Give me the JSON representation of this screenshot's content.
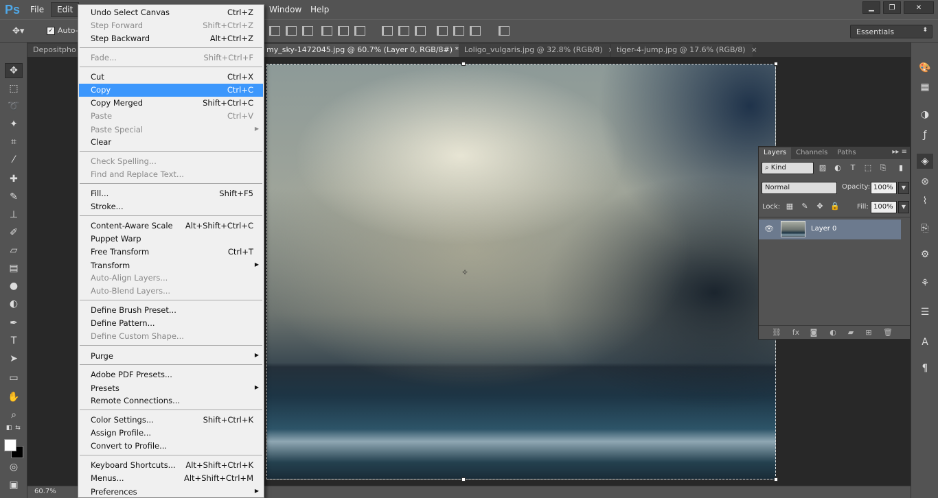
{
  "app": {
    "logo": "Ps"
  },
  "menubar": {
    "items": [
      "File",
      "Edit",
      "Window",
      "Help"
    ]
  },
  "window_controls": {
    "minimize": "▁",
    "restore": "❐",
    "close": "✕"
  },
  "options_bar": {
    "auto_select_label": "Auto-",
    "workspace": "Essentials"
  },
  "tabs": [
    {
      "label": "Depositpho",
      "active": false
    },
    {
      "label": "my_sky-1472045.jpg @ 60.7% (Layer 0, RGB/8#) *",
      "active": true
    },
    {
      "label": "Loligo_vulgaris.jpg @ 32.8% (RGB/8)",
      "active": false
    },
    {
      "label": "tiger-4-jump.jpg @ 17.6% (RGB/8)",
      "active": false
    }
  ],
  "tab_close": "×",
  "status": {
    "zoom": "60.7%"
  },
  "layers_panel": {
    "tabs": [
      "Layers",
      "Channels",
      "Paths"
    ],
    "filter_kind": "Kind",
    "blend_mode": "Normal",
    "opacity_label": "Opacity:",
    "opacity": "100%",
    "lock_label": "Lock:",
    "fill_label": "Fill:",
    "fill": "100%",
    "layers": [
      {
        "name": "Layer 0",
        "visible": true
      }
    ]
  },
  "edit_menu": {
    "items": [
      {
        "label": "Undo Select Canvas",
        "shortcut": "Ctrl+Z",
        "disabled": false
      },
      {
        "label": "Step Forward",
        "shortcut": "Shift+Ctrl+Z",
        "disabled": true
      },
      {
        "label": "Step Backward",
        "shortcut": "Alt+Ctrl+Z",
        "disabled": false
      },
      {
        "label": "Fade...",
        "shortcut": "Shift+Ctrl+F",
        "disabled": true
      },
      {
        "label": "Cut",
        "shortcut": "Ctrl+X",
        "disabled": false
      },
      {
        "label": "Copy",
        "shortcut": "Ctrl+C",
        "disabled": false,
        "highlighted": true
      },
      {
        "label": "Copy Merged",
        "shortcut": "Shift+Ctrl+C",
        "disabled": false
      },
      {
        "label": "Paste",
        "shortcut": "Ctrl+V",
        "disabled": true
      },
      {
        "label": "Paste Special",
        "shortcut": "",
        "disabled": true,
        "submenu": true
      },
      {
        "label": "Clear",
        "shortcut": "",
        "disabled": false
      },
      {
        "label": "Check Spelling...",
        "shortcut": "",
        "disabled": true
      },
      {
        "label": "Find and Replace Text...",
        "shortcut": "",
        "disabled": true
      },
      {
        "label": "Fill...",
        "shortcut": "Shift+F5",
        "disabled": false
      },
      {
        "label": "Stroke...",
        "shortcut": "",
        "disabled": false
      },
      {
        "label": "Content-Aware Scale",
        "shortcut": "Alt+Shift+Ctrl+C",
        "disabled": false
      },
      {
        "label": "Puppet Warp",
        "shortcut": "",
        "disabled": false
      },
      {
        "label": "Free Transform",
        "shortcut": "Ctrl+T",
        "disabled": false
      },
      {
        "label": "Transform",
        "shortcut": "",
        "disabled": false,
        "submenu": true
      },
      {
        "label": "Auto-Align Layers...",
        "shortcut": "",
        "disabled": true
      },
      {
        "label": "Auto-Blend Layers...",
        "shortcut": "",
        "disabled": true
      },
      {
        "label": "Define Brush Preset...",
        "shortcut": "",
        "disabled": false
      },
      {
        "label": "Define Pattern...",
        "shortcut": "",
        "disabled": false
      },
      {
        "label": "Define Custom Shape...",
        "shortcut": "",
        "disabled": true
      },
      {
        "label": "Purge",
        "shortcut": "",
        "disabled": false,
        "submenu": true
      },
      {
        "label": "Adobe PDF Presets...",
        "shortcut": "",
        "disabled": false
      },
      {
        "label": "Presets",
        "shortcut": "",
        "disabled": false,
        "submenu": true
      },
      {
        "label": "Remote Connections...",
        "shortcut": "",
        "disabled": false
      },
      {
        "label": "Color Settings...",
        "shortcut": "Shift+Ctrl+K",
        "disabled": false
      },
      {
        "label": "Assign Profile...",
        "shortcut": "",
        "disabled": false
      },
      {
        "label": "Convert to Profile...",
        "shortcut": "",
        "disabled": false
      },
      {
        "label": "Keyboard Shortcuts...",
        "shortcut": "Alt+Shift+Ctrl+K",
        "disabled": false
      },
      {
        "label": "Menus...",
        "shortcut": "Alt+Shift+Ctrl+M",
        "disabled": false
      },
      {
        "label": "Preferences",
        "shortcut": "",
        "disabled": false,
        "submenu": true
      }
    ]
  },
  "colors": {
    "highlight": "#3c97fc",
    "foreground_color": "#ffffff",
    "background_color": "#000000"
  }
}
